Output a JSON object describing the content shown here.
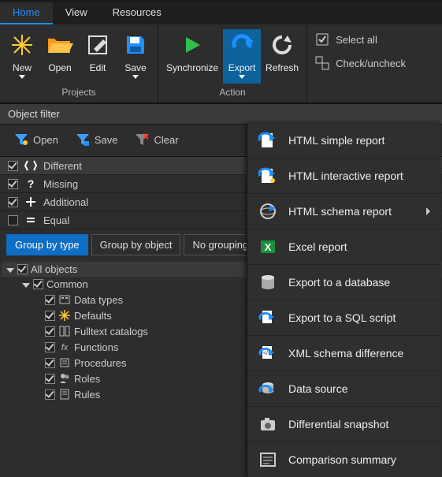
{
  "tabs": {
    "home": "Home",
    "view": "View",
    "resources": "Resources"
  },
  "ribbon": {
    "projects": {
      "label": "Projects",
      "new": "New",
      "open": "Open",
      "edit": "Edit",
      "save": "Save"
    },
    "actions": {
      "label": "Action",
      "sync": "Synchronize",
      "export": "Export",
      "refresh": "Refresh"
    },
    "side": {
      "select_all": "Select all",
      "check_uncheck": "Check/uncheck"
    }
  },
  "filter": {
    "title": "Object filter",
    "open": "Open",
    "save": "Save",
    "clear": "Clear"
  },
  "diff": {
    "different": "Different",
    "missing": "Missing",
    "additional": "Additional",
    "equal": "Equal"
  },
  "grouping": {
    "by_type": "Group by type",
    "by_object": "Group by object",
    "none": "No grouping"
  },
  "tree": {
    "all": "All objects",
    "common": "Common",
    "items": {
      "data_types": "Data types",
      "defaults": "Defaults",
      "fulltext": "Fulltext catalogs",
      "functions": "Functions",
      "procedures": "Procedures",
      "roles": "Roles",
      "rules": "Rules"
    }
  },
  "export_menu": {
    "html_simple": "HTML simple report",
    "html_interactive": "HTML interactive report",
    "html_schema": "HTML schema report",
    "excel": "Excel report",
    "to_db": "Export to a database",
    "to_sql": "Export to a SQL script",
    "xml_diff": "XML schema difference",
    "data_source": "Data source",
    "diff_snapshot": "Differential snapshot",
    "comparison": "Comparison summary"
  },
  "colors": {
    "accent": "#1e90ff",
    "selected": "#0e639c",
    "orange": "#ff8c00",
    "green": "#2fbf4a"
  }
}
